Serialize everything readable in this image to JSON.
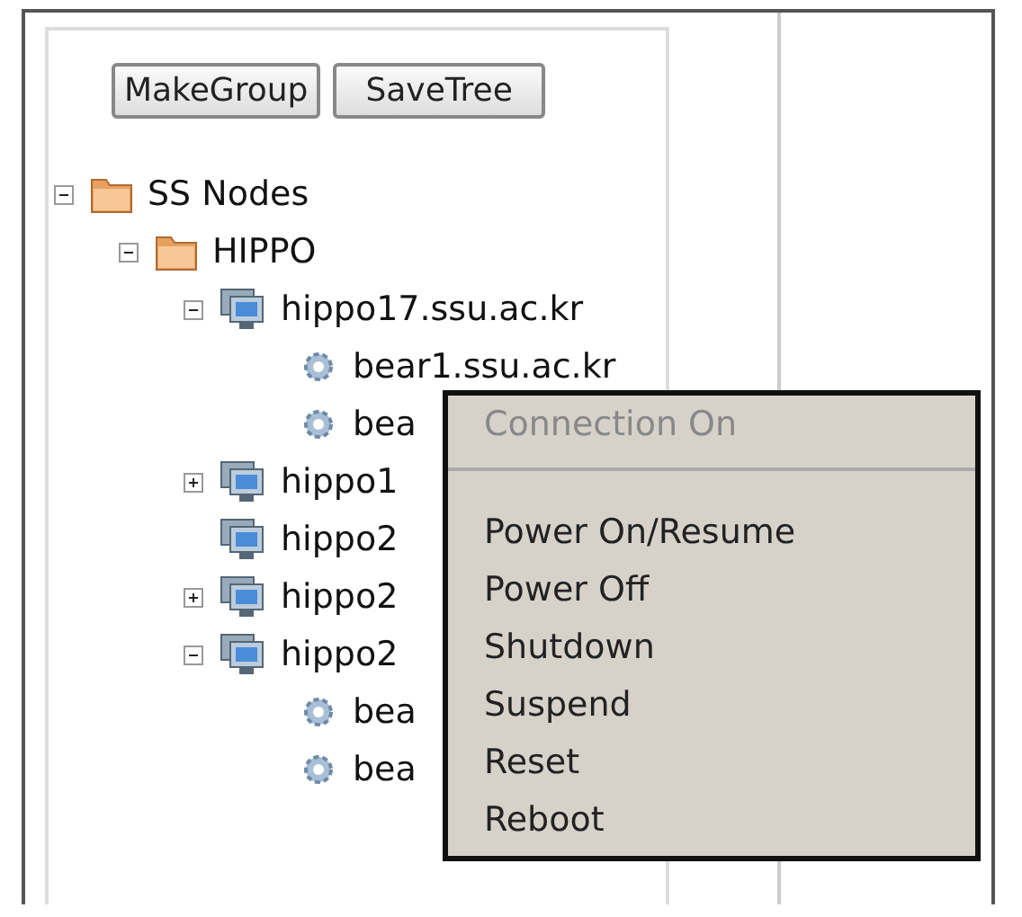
{
  "toolbar": {
    "buttons": [
      "MakeGroup",
      "SaveTree"
    ]
  },
  "tree": [
    {
      "label": "SS Nodes",
      "kind": "folder",
      "expanded": true,
      "children": [
        {
          "label": "HIPPO",
          "kind": "folder",
          "expanded": true,
          "children": [
            {
              "label": "hippo17.ssu.ac.kr",
              "kind": "host",
              "expanded": true,
              "children": [
                {
                  "label": "bear1.ssu.ac.kr",
                  "kind": "vm"
                },
                {
                  "label": "bea",
                  "kind": "vm"
                }
              ]
            },
            {
              "label": "hippo1",
              "kind": "host",
              "expanded": false
            },
            {
              "label": "hippo2",
              "kind": "host"
            },
            {
              "label": "hippo2",
              "kind": "host",
              "expanded": false
            },
            {
              "label": "hippo2",
              "kind": "host",
              "expanded": true,
              "children": [
                {
                  "label": "bea",
                  "kind": "vm"
                },
                {
                  "label": "bea",
                  "kind": "vm"
                }
              ]
            }
          ]
        }
      ]
    }
  ],
  "context_menu": [
    {
      "label": "Connection On",
      "disabled": true
    },
    {
      "kind": "separator"
    },
    {
      "label": "Power On/Resume",
      "disabled": false
    },
    {
      "label": "Power Off",
      "disabled": false
    },
    {
      "label": "Shutdown",
      "disabled": false
    },
    {
      "label": "Suspend",
      "disabled": false
    },
    {
      "label": "Reset",
      "disabled": false
    },
    {
      "label": "Reboot",
      "disabled": false
    }
  ]
}
